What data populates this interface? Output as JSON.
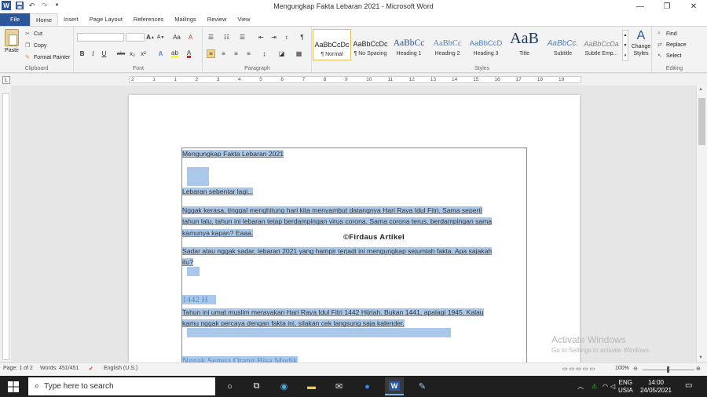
{
  "window": {
    "title": "Mengungkap Fakta Lebaran 2021  -  Microsoft Word"
  },
  "qat": {
    "word_icon": "W",
    "save_icon": "save-icon",
    "undo_icon": "undo-icon",
    "redo_icon": "redo-icon",
    "customize_icon": "chevron-down-icon"
  },
  "tabs": [
    "File",
    "Home",
    "Insert",
    "Page Layout",
    "References",
    "Mailings",
    "Review",
    "View"
  ],
  "ribbon": {
    "clipboard": {
      "label": "Clipboard",
      "paste": "Paste",
      "cut": "Cut",
      "copy": "Copy",
      "format_painter": "Format Painter"
    },
    "font": {
      "label": "Font",
      "bold": "B",
      "italic": "I",
      "underline": "U",
      "strike": "abc",
      "sub": "x₂",
      "sup": "x²",
      "grow": "A▲",
      "shrink": "A▼",
      "case": "Aa",
      "clear": "A"
    },
    "paragraph": {
      "label": "Paragraph",
      "show_marks": "¶"
    },
    "styles": {
      "label": "Styles",
      "items": [
        {
          "preview": "AaBbCcDc",
          "name": "¶ Normal"
        },
        {
          "preview": "AaBbCcDc",
          "name": "¶ No Spacing"
        },
        {
          "preview": "AaBbCc",
          "name": "Heading 1"
        },
        {
          "preview": "AaBbCc",
          "name": "Heading 2"
        },
        {
          "preview": "AaBbCcD",
          "name": "Heading 3"
        },
        {
          "preview": "AaB",
          "name": "Title"
        },
        {
          "preview": "AaBbCc.",
          "name": "Subtitle"
        },
        {
          "preview": "AaBbCcDa",
          "name": "Subtle Emp..."
        }
      ],
      "change_styles": "Change Styles"
    },
    "editing": {
      "label": "Editing",
      "find": "Find",
      "replace": "Replace",
      "select": "Select"
    }
  },
  "ruler": {
    "numbers": [
      "2",
      "1",
      "1",
      "2",
      "3",
      "4",
      "5",
      "6",
      "7",
      "8",
      "9",
      "10",
      "11",
      "12",
      "13",
      "14",
      "15",
      "16",
      "17",
      "18",
      "19"
    ]
  },
  "document": {
    "title": "Mengungkap Fakta Lebaran 2021",
    "p1": "Lebaran sebentar lagi...",
    "p2_l1": "Nggak kerasa, tinggal menghitung hari kita menyambut datangnya Hari Raya Idul Fitri. Sama seperti",
    "p2_l2": "tahun lalu, tahun ini lebaran tetap berdampingan virus corona. Sama corona terus, berdampingan sama",
    "p2_l3": "kamunya kapan? Eaaa.",
    "credit": "©Firdaus Artikel",
    "p3_l1": "Sadar atau nggak sadar, lebaran 2021 yang hampir terjadi ini mengungkap sejumlah fakta. Apa sajakah",
    "p3_l2": "itu?",
    "h1": "1442 H",
    "p4_l1": "Tahun ini umat muslim merayakan Hari Raya Idul Fitri 1442 Hijriah. Bukan 1441, apalagi 1945. Kalau",
    "p4_l2": "kamu nggak percaya dengan fakta ini, silakan cek langsung saja kalender.",
    "h2": "Nggak Semua Orang Bisa Mudik"
  },
  "watermark": {
    "line1": "Activate Windows",
    "line2": "Go to Settings to activate Windows."
  },
  "status": {
    "page": "Page: 1 of 2",
    "words": "Words: 451/451",
    "language": "English (U.S.)",
    "zoom": "100%"
  },
  "taskbar": {
    "search_placeholder": "Type here to search",
    "lang_top": "ENG",
    "lang_bottom": "USIA",
    "time": "14:00",
    "date": "24/05/2021"
  },
  "colors": {
    "accent": "#2b579a",
    "selection": "#a9c8ea",
    "heading": "#5b8ac3",
    "taskbar": "#1f1f1f"
  }
}
